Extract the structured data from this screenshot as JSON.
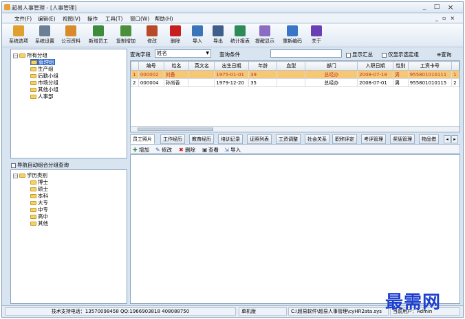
{
  "window": {
    "title": "超易人事管理 - [人事管理]",
    "min": "_",
    "max": "□",
    "close": "×",
    "mdi_controls": "_ ▫ ×"
  },
  "menu": [
    "文件(F)",
    "编辑(E)",
    "视图(V)",
    "操作",
    "工具(T)",
    "窗口(W)",
    "帮助(H)"
  ],
  "toolbar": [
    {
      "label": "系统选项",
      "color": "#e0a030"
    },
    {
      "label": "系统设置",
      "color": "#6b7f95"
    },
    {
      "label": "公司资料",
      "color": "#d98b2b"
    },
    {
      "label": "新增员工",
      "color": "#3c8c3c"
    },
    {
      "label": "复制增加",
      "color": "#4c8f3a"
    },
    {
      "label": "修改",
      "color": "#b84a2a"
    },
    {
      "label": "删除",
      "color": "#c81e1e"
    },
    {
      "label": "导入",
      "color": "#3d73b8"
    },
    {
      "label": "导出",
      "color": "#3f5f8a"
    },
    {
      "label": "统计报表",
      "color": "#2e8b57"
    },
    {
      "label": "提醒显示",
      "color": "#8a6cc4"
    },
    {
      "label": "重新编码",
      "color": "#3a76c7"
    },
    {
      "label": "关于",
      "color": "#6a3fb5"
    }
  ],
  "tree1": {
    "root": "所有分组",
    "items": [
      "管理组",
      "生产组",
      "后勤小组",
      "市场分组",
      "其他小组",
      "人事部"
    ],
    "selected": "管理组"
  },
  "nav_group": {
    "label": "导航自动组合分组查询"
  },
  "tree2": {
    "root": "学历类别",
    "items": [
      "博士",
      "硕士",
      "本科",
      "大专",
      "中专",
      "高中",
      "其他"
    ]
  },
  "query": {
    "field_label": "查询字段",
    "field_value": "姓名",
    "cond_label": "查询条件",
    "cond_value": "",
    "chk_summary": "显示汇总",
    "chk_selected": "仅显示选定组",
    "query_btn": "查询"
  },
  "table": {
    "headers": [
      "",
      "编号",
      "姓名",
      "英文名",
      "出生日期",
      "年龄",
      "血型",
      "部门",
      "入职日期",
      "性别",
      "工资卡号",
      ""
    ],
    "rows": [
      [
        "1",
        "000002",
        "刘备",
        "",
        "1975-01-01",
        "39",
        "",
        "总经办",
        "2008-07-18",
        "男",
        "955801010111",
        "1"
      ],
      [
        "2",
        "000004",
        "孙尚香",
        "",
        "1979-12-20",
        "35",
        "",
        "总经办",
        "2008-07-01",
        "男",
        "955801010115",
        "2"
      ]
    ]
  },
  "tabs": [
    "员工照片",
    "工作经历",
    "教育经历",
    "培训记录",
    "证照列表",
    "工资调整",
    "社会关系",
    "职称评定",
    "考评管理",
    "奖惩管理",
    "物品借"
  ],
  "subtoolbar": [
    "增加",
    "修改",
    "删除",
    "查看",
    "导入"
  ],
  "status": {
    "support": "技术支持电话：13570098458 QQ:1966903818 408088750",
    "mode": "单机版",
    "path": "C:\\超易软件\\超易人事管理\\cyHR2ata.sys",
    "user": "当前用户：Admin"
  },
  "watermark": "最需网",
  "colors": {
    "accent": "#316ac5",
    "highlight_row": "#f7c873",
    "watermark": "#1e3fd0"
  }
}
